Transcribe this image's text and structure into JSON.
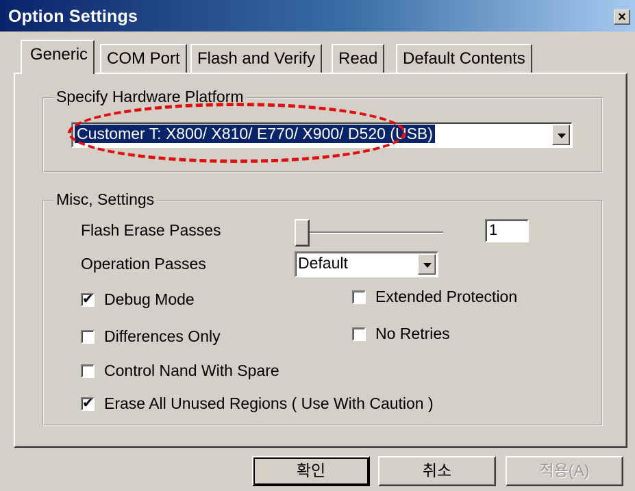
{
  "window": {
    "title": "Option Settings",
    "close_label": "×"
  },
  "tabs": [
    {
      "label": "Generic",
      "active": true
    },
    {
      "label": "COM Port",
      "active": false
    },
    {
      "label": "Flash and Verify",
      "active": false
    },
    {
      "label": "Read",
      "active": false
    },
    {
      "label": "Default Contents",
      "active": false
    }
  ],
  "hardware_group": {
    "label": "Specify Hardware Platform",
    "platform_value": "Customer T: X800/ X810/ E770/ X900/ D520 (USB)"
  },
  "misc_group": {
    "label": "Misc, Settings",
    "flash_erase_passes_label": "Flash Erase Passes",
    "flash_erase_passes_value": "1",
    "slider_level": 0,
    "operation_passes_label": "Operation Passes",
    "operation_passes_value": "Default"
  },
  "checkboxes": {
    "debug_mode": {
      "label": "Debug Mode",
      "checked": true
    },
    "extended_protection": {
      "label": "Extended Protection",
      "checked": false
    },
    "differences_only": {
      "label": "Differences Only",
      "checked": false
    },
    "no_retries": {
      "label": "No Retries",
      "checked": false
    },
    "control_nand": {
      "label": "Control Nand With Spare",
      "checked": false
    },
    "erase_unused": {
      "label": "Erase All Unused Regions ( Use With Caution )",
      "checked": true
    }
  },
  "checkmark": "✔",
  "buttons": {
    "ok": "확인",
    "cancel": "취소",
    "apply": "적용(A)"
  },
  "colors": {
    "titlebar_start": "#0a246a",
    "titlebar_end": "#a6caf0",
    "selection": "#0a246a",
    "annotation": "#e01010"
  }
}
